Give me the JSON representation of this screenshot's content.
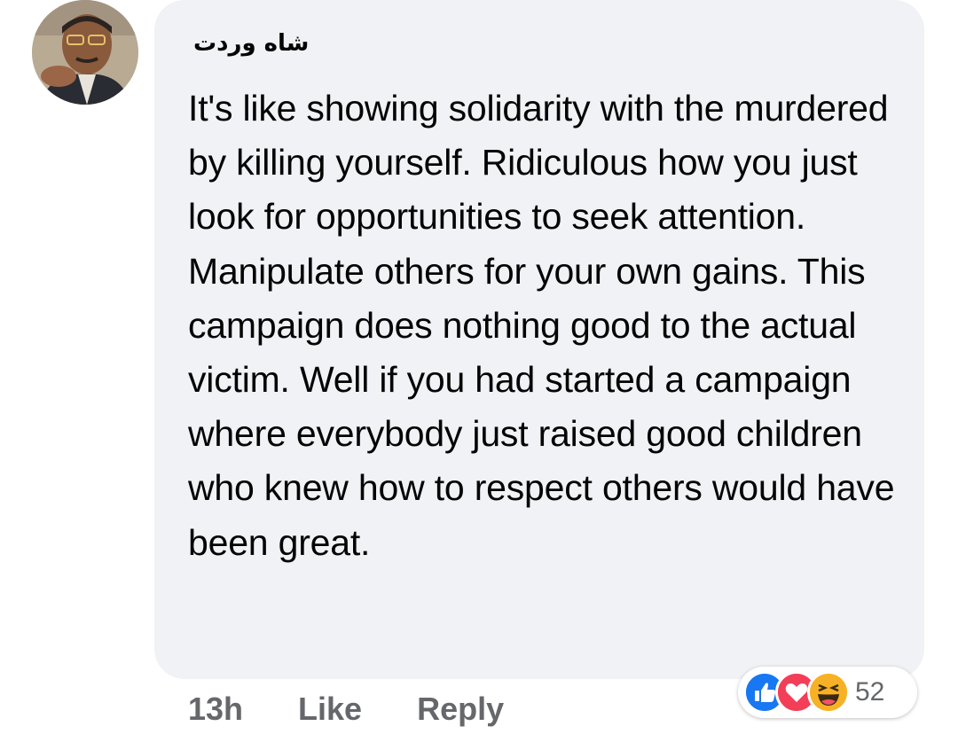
{
  "comment": {
    "author": "شاه وردت",
    "text": "It's like showing solidarity with the murdered by killing yourself. Ridiculous how you just look for opportunities to seek attention. Manipulate others for your own gains. This campaign does nothing good to the actual victim. Well if you had started a campaign where everybody just raised good children who knew how to respect others would have been great.",
    "timestamp": "13h",
    "like_label": "Like",
    "reply_label": "Reply"
  },
  "reactions": {
    "types": [
      "like-icon",
      "love-icon",
      "haha-icon"
    ],
    "count": "52"
  },
  "colors": {
    "bubble": "#f0f2f5",
    "text": "#050505",
    "secondary": "#65676b",
    "like_blue": "#1877f2",
    "love_red": "#f33e58",
    "haha_yellow": "#f7b125"
  }
}
